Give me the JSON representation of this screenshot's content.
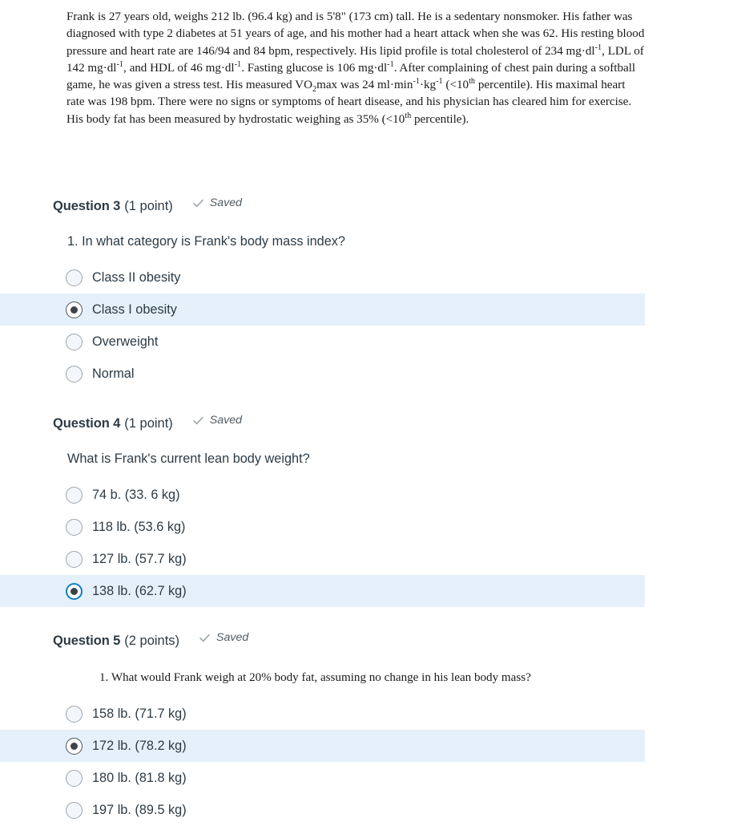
{
  "case_study": {
    "segments": [
      {
        "t": "Frank is 27 years old, weighs 212 lb. (96.4 kg) and is 5'8\" (173 cm) tall. He is a sedentary nonsmoker. His father was diagnosed with type 2 diabetes at 51 years of age, and his mother had a heart attack when she was 62. His resting blood pressure and heart rate are 146/94 and 84 bpm, respectively. His lipid profile is total cholesterol of 234 mg·dl"
      },
      {
        "t": "-1",
        "sup": true
      },
      {
        "t": ", LDL of 142 mg·dl"
      },
      {
        "t": "-1",
        "sup": true
      },
      {
        "t": ", and HDL of 46 mg·dl"
      },
      {
        "t": "-1",
        "sup": true
      },
      {
        "t": ". Fasting glucose is 106 mg·dl"
      },
      {
        "t": "-1",
        "sup": true
      },
      {
        "t": ". After complaining of chest pain during a softball game, he was given a stress test. His measured VO"
      },
      {
        "t": "2",
        "sub": true
      },
      {
        "t": "max was 24 ml·min"
      },
      {
        "t": "-1",
        "sup": true
      },
      {
        "t": "·kg"
      },
      {
        "t": "-1",
        "sup": true
      },
      {
        "t": " (<10"
      },
      {
        "t": "th",
        "sup": true
      },
      {
        "t": " percentile). His maximal heart rate was 198 bpm. There were no signs or symptoms of heart disease, and his physician has cleared him for exercise. His body fat has been measured by hydrostatic weighing as 35% (<10"
      },
      {
        "t": "th",
        "sup": true
      },
      {
        "t": " percentile)."
      }
    ]
  },
  "questions": [
    {
      "title": "Question 3",
      "points": "(1 point)",
      "status": "Saved",
      "prompt": "1. In what category is Frank's body mass index?",
      "prompt_style": "sans",
      "options": [
        {
          "label": "Class II obesity",
          "selected": false,
          "focused": false
        },
        {
          "label": "Class I obesity",
          "selected": true,
          "focused": false
        },
        {
          "label": "Overweight",
          "selected": false,
          "focused": false
        },
        {
          "label": "Normal",
          "selected": false,
          "focused": false
        }
      ]
    },
    {
      "title": "Question 4",
      "points": "(1 point)",
      "status": "Saved",
      "prompt": "What is Frank's current lean body weight?",
      "prompt_style": "sans",
      "options": [
        {
          "label": "74 b. (33. 6 kg)",
          "selected": false,
          "focused": false
        },
        {
          "label": "118 lb. (53.6 kg)",
          "selected": false,
          "focused": false
        },
        {
          "label": "127 lb. (57.7 kg)",
          "selected": false,
          "focused": false
        },
        {
          "label": "138 lb. (62.7 kg)",
          "selected": true,
          "focused": true
        }
      ]
    },
    {
      "title": "Question 5",
      "points": "(2 points)",
      "status": "Saved",
      "prompt": "1. What would Frank weigh at 20% body fat, assuming no change in his lean body mass?",
      "prompt_style": "serif",
      "options": [
        {
          "label": "158 lb. (71.7 kg)",
          "selected": false,
          "focused": false
        },
        {
          "label": "172 lb. (78.2 kg)",
          "selected": true,
          "focused": false
        },
        {
          "label": "180 lb. (81.8 kg)",
          "selected": false,
          "focused": false
        },
        {
          "label": "197 lb. (89.5 kg)",
          "selected": false,
          "focused": false
        }
      ]
    }
  ],
  "colors": {
    "selected_row_bg": "#e5f0fa",
    "text": "#2d3b45",
    "focus_ring": "#0f7ecb",
    "check_icon": "#9aa5ab"
  },
  "icons": {
    "check": "check-icon"
  }
}
